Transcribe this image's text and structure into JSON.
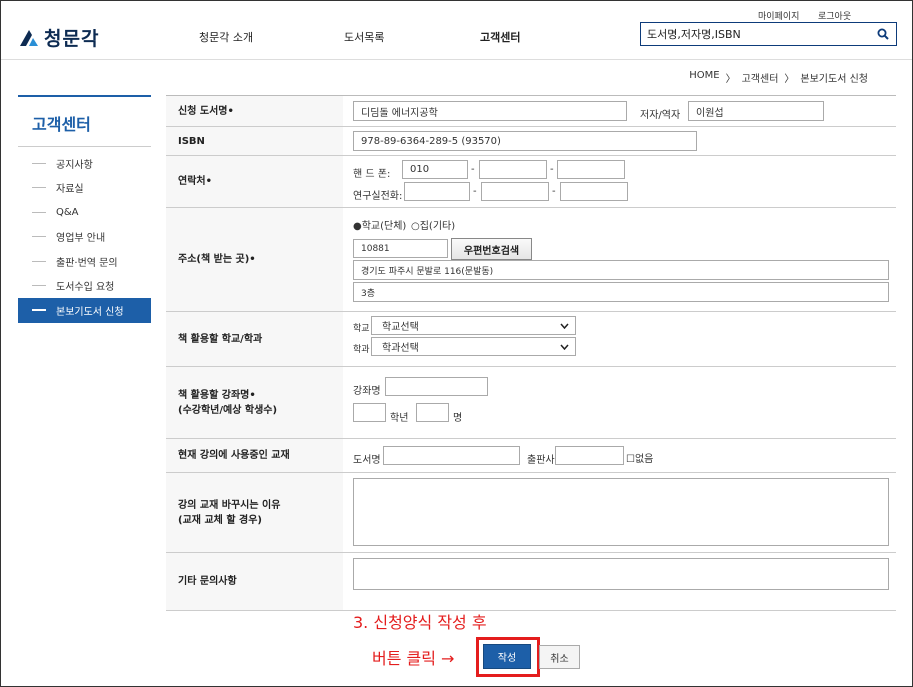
{
  "header": {
    "logo_text": "청문각",
    "util_links": [
      "마이페이지",
      "로그아웃"
    ],
    "nav": [
      "청문각 소개",
      "도서목록",
      "고객센터"
    ],
    "search_placeholder": "도서명,저자명,ISBN"
  },
  "breadcrumb": [
    "HOME",
    "〉",
    "고객센터",
    "〉",
    "본보기도서 신청"
  ],
  "sidebar": {
    "title": "고객센터",
    "items": [
      "공지사항",
      "자료실",
      "Q&A",
      "영업부 안내",
      "출판·번역 문의",
      "도서수입 요청",
      "본보기도서 신청"
    ],
    "active_index": 6
  },
  "form": {
    "book_title": {
      "label": "신청 도서명•",
      "value": "디딤돌 에너지공학",
      "author_label": "저자/역자",
      "author_value": "이원섭"
    },
    "isbn": {
      "label": "ISBN",
      "value": "978-89-6364-289-5 (93570)"
    },
    "contact": {
      "label": "연락처•",
      "mobile_label": "핸 드 폰:",
      "mobile_prefix": "010",
      "lab_label": "연구실전화:",
      "dash": "-"
    },
    "address": {
      "label": "주소(책 받는 곳)•",
      "radio_school": "●학교(단체)",
      "radio_home": "○집(기타)",
      "zipcode": "10881",
      "zip_button": "우편번호검색",
      "address1": "경기도 파주시 문발로 116(문발동)",
      "address2": "3층"
    },
    "school": {
      "label": "책 활용할 학교/학과",
      "school_label": "학교",
      "school_select": "학교선택",
      "dept_label": "학과",
      "dept_select": "학과선택"
    },
    "course": {
      "label_line1": "책 활용할 강좌명•",
      "label_line2": "(수강학년/예상 학생수)",
      "course_label": "강좌명",
      "grade_label": "학년",
      "count_label": "명"
    },
    "current_text": {
      "label": "현재 강의에 사용중인 교재",
      "title_label": "도서명",
      "publisher_label": "출판사",
      "none_label": "☐없음"
    },
    "reason": {
      "label_line1": "강의 교재 바꾸시는 이유",
      "label_line2": "(교재 교체 할 경우)"
    },
    "other": {
      "label": "기타 문의사항"
    }
  },
  "buttons": {
    "submit": "작성",
    "cancel": "취소"
  },
  "annotation": {
    "line1": "3. 신청양식 작성 후",
    "line2": "버튼 클릭 →"
  },
  "colors": {
    "primary": "#1d5fa8",
    "annotation": "#e41d1d",
    "logo": "#0d2b52"
  }
}
